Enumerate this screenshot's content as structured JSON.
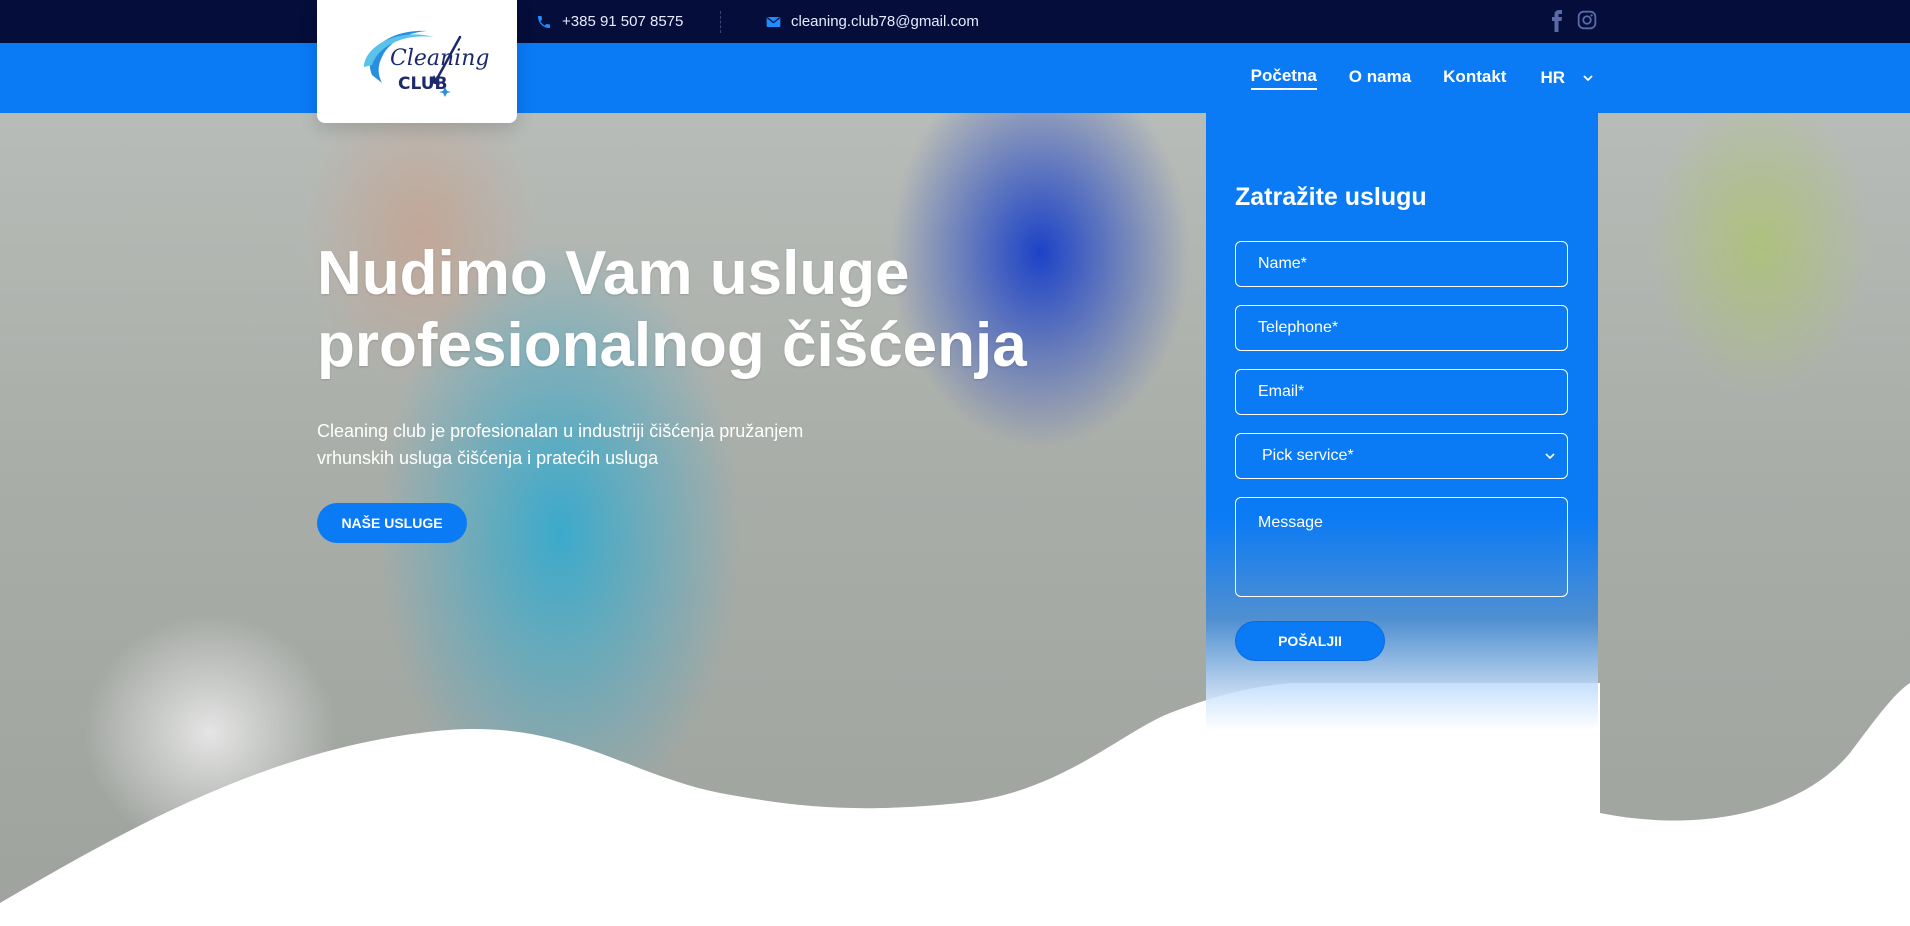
{
  "topbar": {
    "phone": "+385 91 507 8575",
    "email": "cleaning.club78@gmail.com",
    "social": [
      "facebook-icon",
      "instagram-icon"
    ]
  },
  "logo": {
    "line1": "Cleaning",
    "line2": "CLUB"
  },
  "nav": {
    "items": [
      {
        "label": "Početna",
        "active": true
      },
      {
        "label": "O nama",
        "active": false
      },
      {
        "label": "Kontakt",
        "active": false
      }
    ],
    "language": "HR"
  },
  "hero": {
    "title_line1": "Nudimo Vam usluge",
    "title_line2": "profesionalnog čišćenja",
    "text_line1": "Cleaning club je profesionalan u industriji čišćenja pružanjem",
    "text_line2": "vrhunskih usluga čišćenja i pratećih usluga",
    "button": "NAŠE USLUGE"
  },
  "form": {
    "title": "Zatražite uslugu",
    "name_placeholder": "Name*",
    "telephone_placeholder": "Telephone*",
    "email_placeholder": "Email*",
    "service_selected": "Pick service*",
    "message_placeholder": "Message",
    "submit": "POŠALJII"
  },
  "colors": {
    "topbar": "#050d3a",
    "brand_blue": "#0a7af5",
    "white": "#ffffff"
  }
}
